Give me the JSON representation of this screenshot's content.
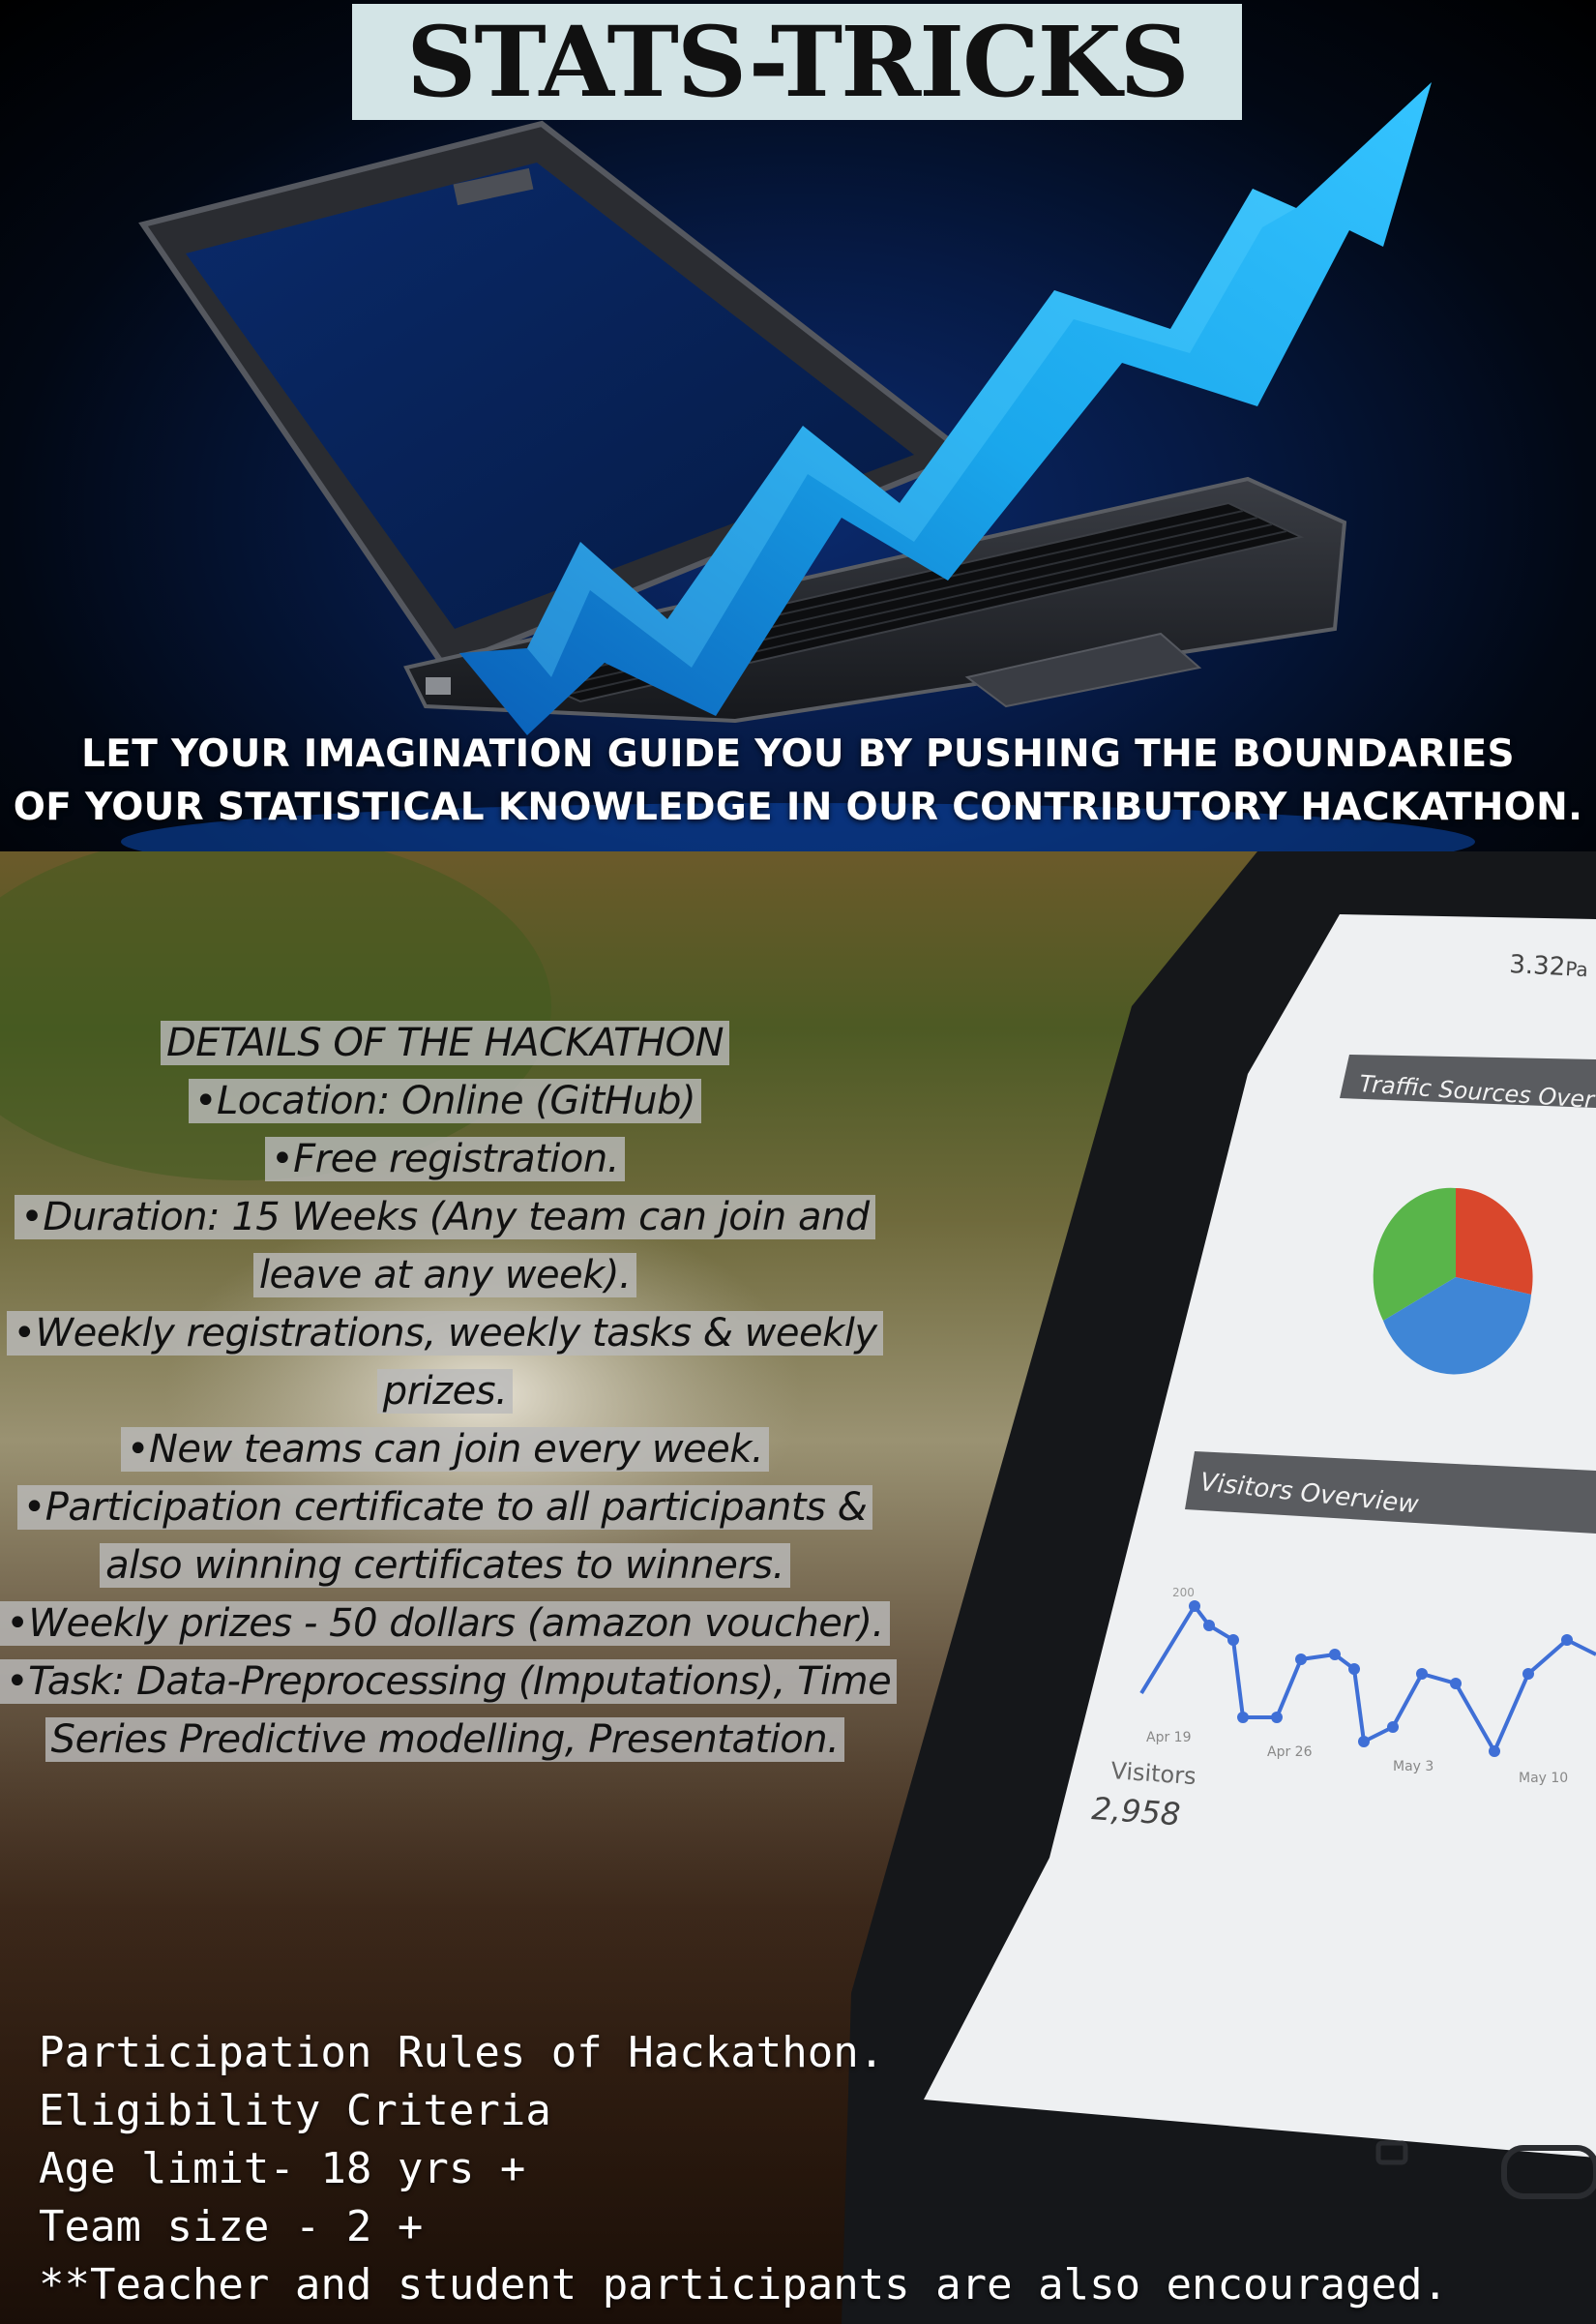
{
  "hero": {
    "title": "STATS-TRICKS",
    "tagline_line1": "LET YOUR IMAGINATION GUIDE YOU BY PUSHING THE BOUNDARIES",
    "tagline_line2": "OF YOUR STATISTICAL KNOWLEDGE IN OUR CONTRIBUTORY HACKATHON."
  },
  "details": {
    "lines": [
      "DETAILS OF THE HACKATHON",
      "•Location: Online (GitHub)",
      "•Free registration.",
      "•Duration: 15 Weeks (Any team can join and",
      "leave at any week).",
      "•Weekly registrations, weekly tasks & weekly",
      "prizes.",
      "•New teams can join every week.",
      "•Participation certificate to all participants &",
      "also winning certificates to winners.",
      "•Weekly prizes - 50 dollars (amazon voucher).",
      "•Task: Data-Preprocessing (Imputations), Time",
      "Series Predictive modelling, Presentation."
    ]
  },
  "tablet": {
    "page_count": "3.32",
    "page_suffix": "Pa",
    "traffic_title": "Traffic Sources Overview",
    "visitors_title": "Visitors Overview",
    "axis_tick": "200",
    "date_labels": [
      "Apr 19",
      "Apr 26",
      "May 3",
      "May 10"
    ],
    "visitors_label": "Visitors",
    "visitors_value": "2,958"
  },
  "rules": {
    "lines": [
      "Participation Rules of Hackathon.",
      "Eligibility Criteria",
      "Age limit- 18 yrs +",
      "Team size - 2 +",
      "**Teacher and student participants are also encouraged."
    ]
  },
  "colors": {
    "arrow": "#1aa7ec",
    "title_box": "#d3e4e6",
    "highlight": "#b9b9b9",
    "pie_green": "#59b54a",
    "pie_red": "#d9472c",
    "pie_blue": "#3f86d6"
  }
}
